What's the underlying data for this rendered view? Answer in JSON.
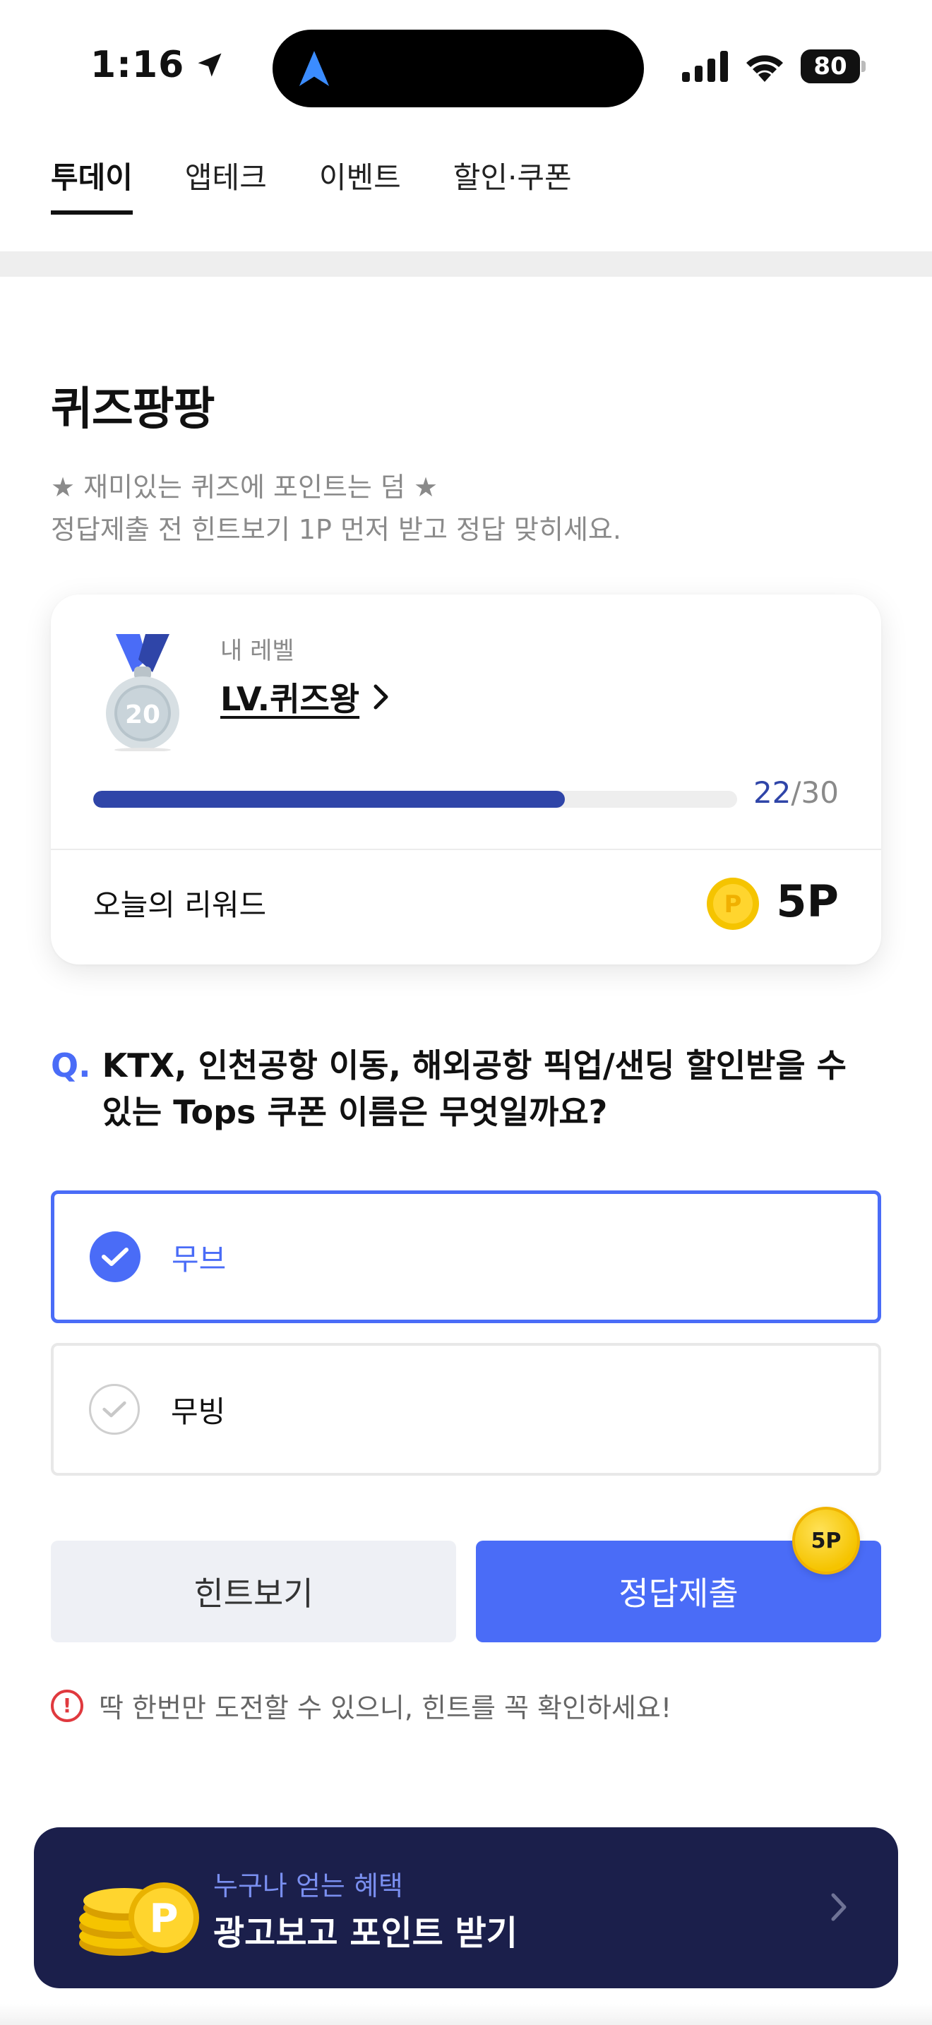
{
  "status_bar": {
    "time": "1:16",
    "battery": "80"
  },
  "tabs": [
    {
      "label": "투데이",
      "active": true
    },
    {
      "label": "앱테크",
      "active": false
    },
    {
      "label": "이벤트",
      "active": false
    },
    {
      "label": "할인·쿠폰",
      "active": false
    }
  ],
  "section": {
    "title": "퀴즈팡팡",
    "subtitle_line1": "★ 재미있는 퀴즈에 포인트는 덤 ★",
    "subtitle_line2": "정답제출 전 힌트보기 1P 먼저 받고 정답 맞히세요."
  },
  "level_card": {
    "medal_level": "20",
    "caption": "내 레벨",
    "level_name": "LV.퀴즈왕",
    "progress_current": "22",
    "progress_total": "/30",
    "progress_fraction": 0.733,
    "reward_label": "오늘의 리워드",
    "reward_coin_letter": "P",
    "reward_value": "5P"
  },
  "question": {
    "prefix": "Q.",
    "text": "KTX, 인천공항 이동, 해외공항 픽업/샌딩 할인받을 수 있는 Tops 쿠폰 이름은 무엇일까요?"
  },
  "options": [
    {
      "label": "무브",
      "selected": true
    },
    {
      "label": "무빙",
      "selected": false
    }
  ],
  "buttons": {
    "hint": "힌트보기",
    "submit": "정답제출",
    "submit_badge": "5P"
  },
  "warning": {
    "icon": "!",
    "text": "딱 한번만 도전할 수 있으니, 힌트를 꼭 확인하세요!"
  },
  "banner": {
    "subtitle": "누구나 얻는 혜택",
    "title": "광고보고 포인트 받기",
    "coin_letter": "P"
  },
  "colors": {
    "accent": "#4a6cf7",
    "progress": "#2f45a8",
    "banner_bg": "#1b1f4b",
    "coin": "#f5c400",
    "warning": "#e0393e"
  }
}
